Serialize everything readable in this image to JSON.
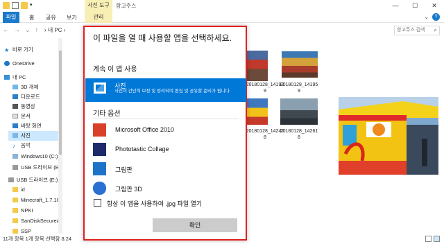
{
  "window": {
    "title": "항고주스",
    "context_tab": "사진 도구",
    "controls": [
      "—",
      "☐",
      "✕"
    ]
  },
  "ribbon": {
    "tabs": [
      "파일",
      "홈",
      "공유",
      "보기",
      "관리"
    ],
    "help": "?"
  },
  "address": {
    "path": "› 내 PC ›",
    "search_placeholder": "항고주스 검색"
  },
  "sidebar": {
    "items": [
      {
        "label": "바로 가기",
        "icon": "star-icon"
      },
      {
        "label": "OneDrive",
        "icon": "cloud-icon"
      },
      {
        "label": "내 PC",
        "icon": "pc-icon"
      },
      {
        "label": "3D 개체",
        "icon": "cube-icon"
      },
      {
        "label": "다운로드",
        "icon": "download-icon"
      },
      {
        "label": "동영상",
        "icon": "video-icon"
      },
      {
        "label": "문서",
        "icon": "document-icon"
      },
      {
        "label": "바탕 화면",
        "icon": "desktop-icon"
      },
      {
        "label": "사진",
        "icon": "pictures-icon"
      },
      {
        "label": "음악",
        "icon": "music-icon"
      },
      {
        "label": "Windows10 (C:)",
        "icon": "drive-icon"
      },
      {
        "label": "USB 드라이브 (E:",
        "icon": "usb-icon"
      },
      {
        "label": "USB 드라이브 (E:)",
        "icon": "usb-icon"
      },
      {
        "label": "id",
        "icon": "folder-icon"
      },
      {
        "label": "Minecraft_1.7.10",
        "icon": "folder-icon"
      },
      {
        "label": "NPKI",
        "icon": "folder-icon"
      },
      {
        "label": "SanDiskSecureA",
        "icon": "folder-icon"
      },
      {
        "label": "SSP",
        "icon": "folder-icon"
      }
    ]
  },
  "files": [
    {
      "label": "",
      "top": false
    },
    {
      "label": "20180128_14192\n9",
      "top": false
    },
    {
      "label": "20180128_14195\n9",
      "top": false
    },
    {
      "label": "20180128_14242\n8",
      "top": false
    },
    {
      "label": "20180128_14261\n8",
      "top": false
    }
  ],
  "status": {
    "text": "11개 항목   1개 항목 선택함 8.24"
  },
  "dialog": {
    "title": "이 파일을 열 때 사용할 앱을 선택하세요.",
    "keep_section": "계속 이 앱 사용",
    "selected_app": {
      "name": "사진",
      "description": "사진이 간단히 보정 및 정리되며 편집 및 공유할 준비가 됩니다."
    },
    "other_section": "기타 옵션",
    "apps": [
      {
        "name": "Microsoft Office 2010",
        "icon": "office-icon"
      },
      {
        "name": "Phototastic Collage",
        "icon": "collage-icon"
      },
      {
        "name": "그림판",
        "icon": "paint-icon"
      },
      {
        "name": "그림판 3D",
        "icon": "paint3d-icon"
      }
    ],
    "always_use": "항상 이 앱을 사용하여 .jpg 파일 열기",
    "ok": "확인"
  }
}
